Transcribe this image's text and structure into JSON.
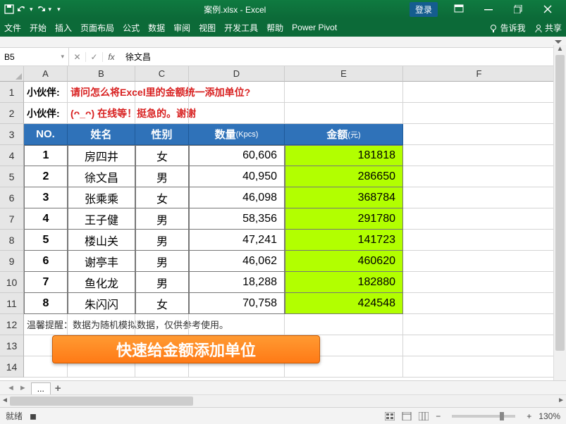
{
  "titlebar": {
    "document": "案例.xlsx",
    "app": "Excel",
    "login": "登录"
  },
  "ribbon": {
    "tabs": [
      "文件",
      "开始",
      "插入",
      "页面布局",
      "公式",
      "数据",
      "审阅",
      "视图",
      "开发工具",
      "帮助",
      "Power Pivot"
    ],
    "tellme": "告诉我",
    "share": "共享"
  },
  "formula": {
    "name_box": "B5",
    "value": "徐文昌"
  },
  "columns": [
    "A",
    "B",
    "C",
    "D",
    "E",
    "F"
  ],
  "row_headers": [
    "1",
    "2",
    "3",
    "4",
    "5",
    "6",
    "7",
    "8",
    "9",
    "10",
    "11",
    "12",
    "13",
    "14"
  ],
  "q1_label": "小伙伴:",
  "q1_text": "请问怎么将Excel里的金额统一添加单位?",
  "q2_label": "小伙伴:",
  "q2_text": "(ᴖ_ᴖ) 在线等！挺急的。谢谢",
  "headers": {
    "no": "NO.",
    "name": "姓名",
    "gender": "性别",
    "qty": "数量",
    "qty_sub": "(Kpcs)",
    "amt": "金额",
    "amt_sub": "(元)"
  },
  "data": [
    {
      "no": "1",
      "name": "房四井",
      "gender": "女",
      "qty": "60,606",
      "amt": "181818"
    },
    {
      "no": "2",
      "name": "徐文昌",
      "gender": "男",
      "qty": "40,950",
      "amt": "286650"
    },
    {
      "no": "3",
      "name": "张乘乘",
      "gender": "女",
      "qty": "46,098",
      "amt": "368784"
    },
    {
      "no": "4",
      "name": "王子健",
      "gender": "男",
      "qty": "58,356",
      "amt": "291780"
    },
    {
      "no": "5",
      "name": "楼山关",
      "gender": "男",
      "qty": "47,241",
      "amt": "141723"
    },
    {
      "no": "6",
      "name": "谢亭丰",
      "gender": "男",
      "qty": "46,062",
      "amt": "460620"
    },
    {
      "no": "7",
      "name": "鱼化龙",
      "gender": "男",
      "qty": "18,288",
      "amt": "182880"
    },
    {
      "no": "8",
      "name": "朱闪闪",
      "gender": "女",
      "qty": "70,758",
      "amt": "424548"
    }
  ],
  "note": "温馨提醒：数据为随机模拟数据，仅供参考使用。",
  "banner": "快速给金额添加单位",
  "sheet": {
    "dots": "...",
    "plus": "+"
  },
  "status": {
    "ready": "就绪",
    "rec": "",
    "zoom": "130%"
  }
}
